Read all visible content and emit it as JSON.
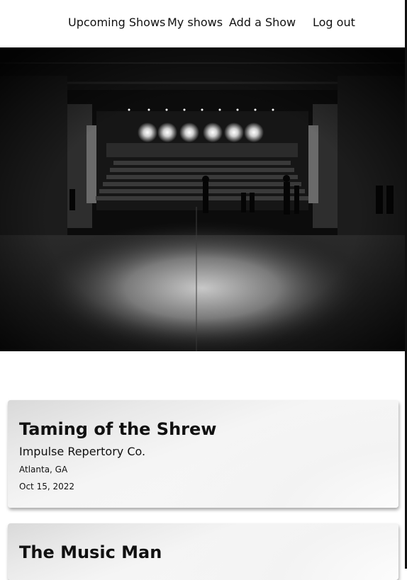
{
  "nav": {
    "upcoming_label": "Upcoming Shows",
    "my_shows_label": "My shows",
    "add_show_label": "Add a Show",
    "logout_label": "Log out"
  },
  "hero": {
    "image": "theater-stage-photo"
  },
  "shows": [
    {
      "title": "Taming of the Shrew",
      "company": "Impulse Repertory Co.",
      "location": "Atlanta, GA",
      "date": "Oct 15, 2022"
    },
    {
      "title": "The Music Man"
    }
  ]
}
